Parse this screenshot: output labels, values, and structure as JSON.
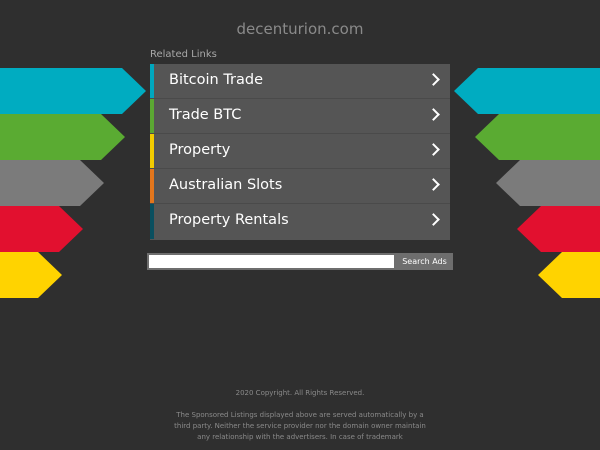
{
  "header": {
    "domain": "decenturion.com"
  },
  "related": {
    "label": "Related Links",
    "links": [
      {
        "label": "Bitcoin Trade",
        "color": "#00a7be"
      },
      {
        "label": "Trade BTC",
        "color": "#5ba732"
      },
      {
        "label": "Property",
        "color": "#f3cc00"
      },
      {
        "label": "Australian Slots",
        "color": "#e3761c"
      },
      {
        "label": "Property Rentals",
        "color": "#0a4f5f"
      }
    ]
  },
  "arrows": {
    "colors": [
      "#00acc1",
      "#5aab32",
      "#7b7b7b",
      "#e2102f",
      "#ffd300"
    ]
  },
  "search": {
    "value": "",
    "button_label": "Search Ads"
  },
  "footer": {
    "copyright": "2020 Copyright. All Rights Reserved.",
    "disclaimer": "The Sponsored Listings displayed above are served automatically by a third party. Neither the service provider nor the domain owner maintain any relationship with the advertisers. In case of trademark"
  }
}
